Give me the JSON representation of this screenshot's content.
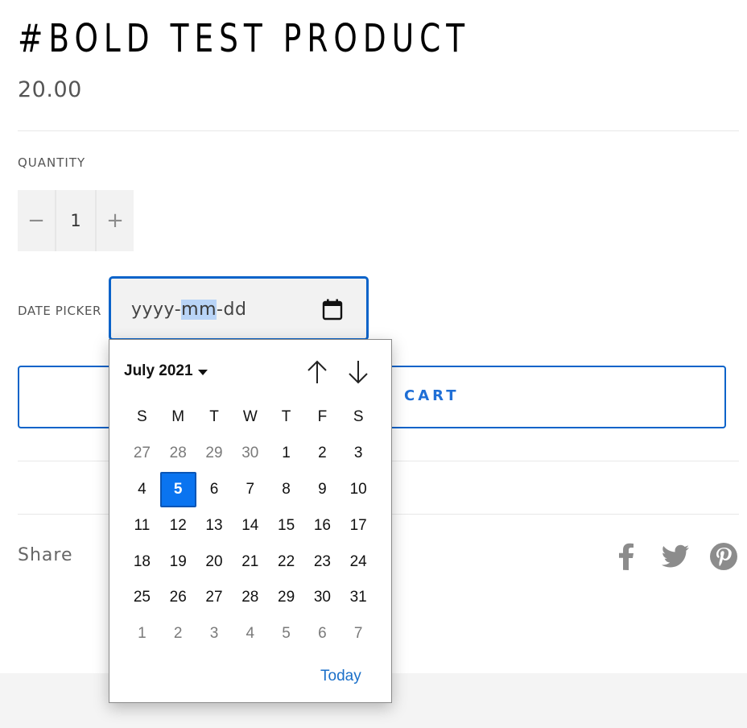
{
  "product": {
    "title": "#BOLD TEST PRODUCT",
    "price": "20.00"
  },
  "quantity": {
    "label": "QUANTITY",
    "minus": "−",
    "value": "1",
    "plus": "+"
  },
  "date_picker": {
    "label": "DATE PICKER",
    "placeholder_year": "yyyy",
    "separator": "-",
    "placeholder_month": "mm",
    "placeholder_day": "dd",
    "icon": "calendar-icon"
  },
  "cart": {
    "label": "ADD TO CART",
    "visible_label": "CART"
  },
  "share": {
    "label": "Share",
    "icons": [
      "facebook-icon",
      "twitter-icon",
      "pinterest-icon"
    ]
  },
  "calendar": {
    "month_label": "July 2021",
    "weekdays": [
      "S",
      "M",
      "T",
      "W",
      "T",
      "F",
      "S"
    ],
    "weeks": [
      [
        {
          "d": "27",
          "m": true
        },
        {
          "d": "28",
          "m": true
        },
        {
          "d": "29",
          "m": true
        },
        {
          "d": "30",
          "m": true
        },
        {
          "d": "1"
        },
        {
          "d": "2"
        },
        {
          "d": "3"
        }
      ],
      [
        {
          "d": "4"
        },
        {
          "d": "5",
          "sel": true
        },
        {
          "d": "6"
        },
        {
          "d": "7"
        },
        {
          "d": "8"
        },
        {
          "d": "9"
        },
        {
          "d": "10"
        }
      ],
      [
        {
          "d": "11"
        },
        {
          "d": "12"
        },
        {
          "d": "13"
        },
        {
          "d": "14"
        },
        {
          "d": "15"
        },
        {
          "d": "16"
        },
        {
          "d": "17"
        }
      ],
      [
        {
          "d": "18"
        },
        {
          "d": "19"
        },
        {
          "d": "20"
        },
        {
          "d": "21"
        },
        {
          "d": "22"
        },
        {
          "d": "23"
        },
        {
          "d": "24"
        }
      ],
      [
        {
          "d": "25"
        },
        {
          "d": "26"
        },
        {
          "d": "27"
        },
        {
          "d": "28"
        },
        {
          "d": "29"
        },
        {
          "d": "30"
        },
        {
          "d": "31"
        }
      ],
      [
        {
          "d": "1",
          "m": true
        },
        {
          "d": "2",
          "m": true
        },
        {
          "d": "3",
          "m": true
        },
        {
          "d": "4",
          "m": true
        },
        {
          "d": "5",
          "m": true
        },
        {
          "d": "6",
          "m": true
        },
        {
          "d": "7",
          "m": true
        }
      ]
    ],
    "today_label": "Today"
  },
  "colors": {
    "accent": "#0a63c9",
    "selected_day": "#0a74f0",
    "icon_gray": "#8c8c8c"
  }
}
